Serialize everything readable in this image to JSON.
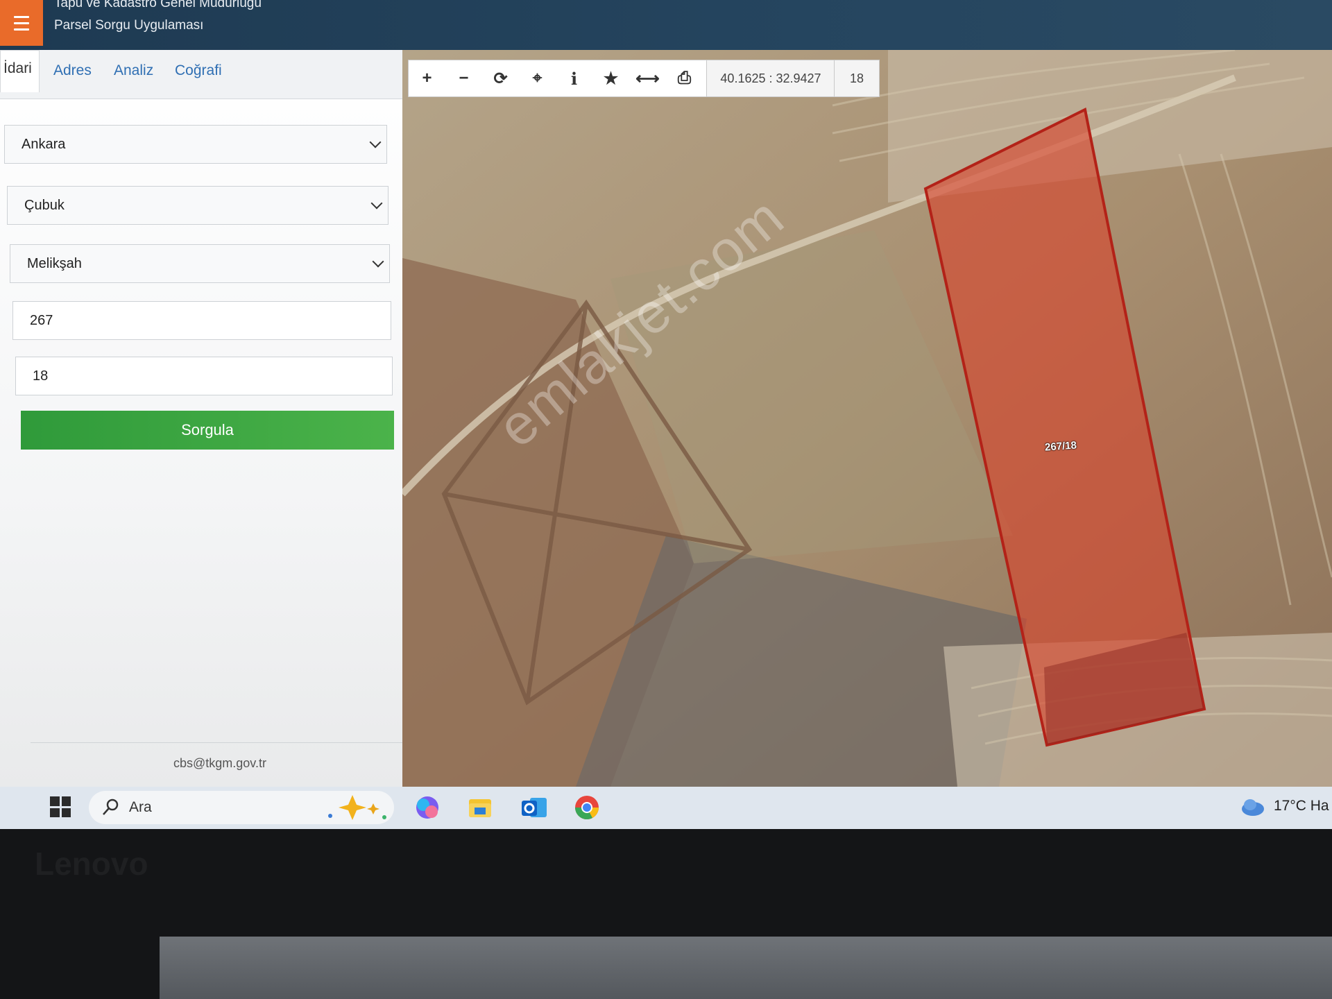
{
  "header": {
    "title": "Tapu ve Kadastro Genel Müdürlüğü",
    "subtitle": "Parsel Sorgu Uygulaması"
  },
  "tabs": [
    {
      "label": "İdari"
    },
    {
      "label": "Adres"
    },
    {
      "label": "Analiz"
    },
    {
      "label": "Coğrafi"
    }
  ],
  "form": {
    "province": "Ankara",
    "district": "Çubuk",
    "neighborhood": "Melikşah",
    "block": "267",
    "parcel": "18",
    "submit_label": "Sorgula"
  },
  "footer": {
    "email": "cbs@tkgm.gov.tr"
  },
  "map": {
    "coordinates": "40.1625 : 32.9427",
    "zoom": "18",
    "parcel_label": "267/18",
    "watermark": "emlakjet.com"
  },
  "toolbar": {
    "icons": [
      "plus-icon",
      "minus-icon",
      "refresh-icon",
      "locate-icon",
      "info-icon",
      "star-icon",
      "measure-icon",
      "print-icon"
    ]
  },
  "taskbar": {
    "search_label": "Ara",
    "temperature": "17°C Ha"
  },
  "bezel": {
    "brand": "Lenovo"
  },
  "colors": {
    "header": "#25455f",
    "menu_button": "#e96b2a",
    "query_button": "#3ea644",
    "parcel_fill": "#d9432b",
    "link": "#2f6fb3"
  }
}
